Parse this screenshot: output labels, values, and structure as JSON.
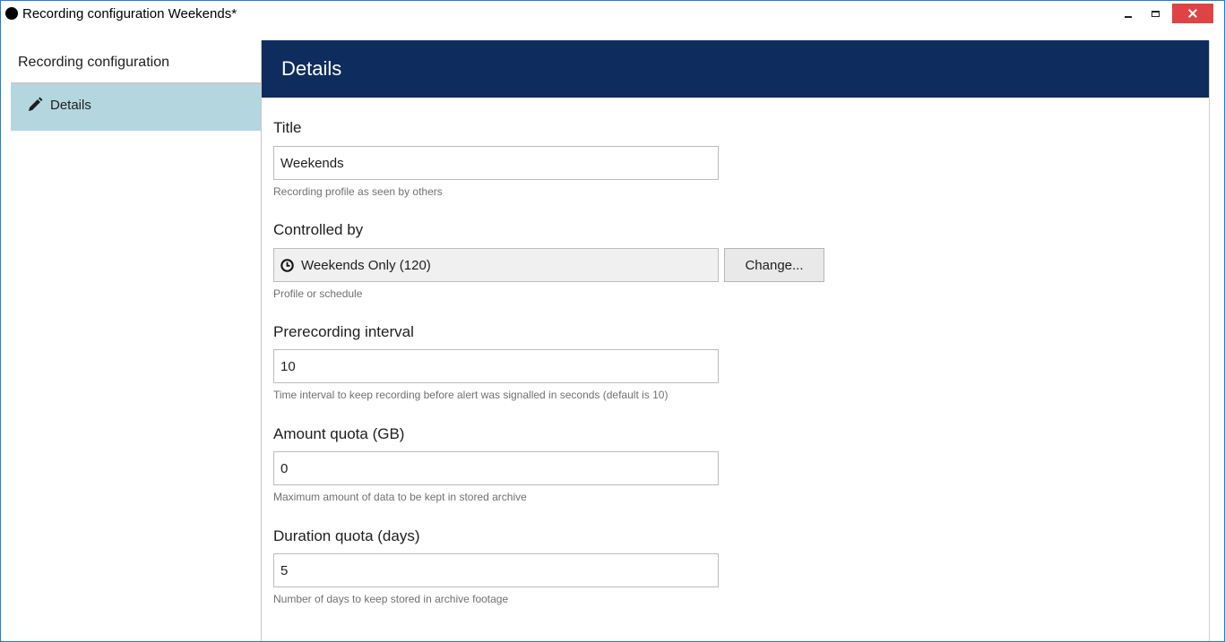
{
  "window": {
    "title": "Recording configuration Weekends*"
  },
  "sidebar": {
    "header": "Recording configuration",
    "items": [
      {
        "label": "Details",
        "icon": "pencil-icon",
        "selected": true
      }
    ]
  },
  "main": {
    "header": "Details",
    "fields": {
      "title": {
        "label": "Title",
        "value": "Weekends",
        "hint": "Recording profile as seen by others"
      },
      "controlled_by": {
        "label": "Controlled by",
        "value": "Weekends Only (120)",
        "icon": "clock-icon",
        "button": "Change...",
        "hint": "Profile or schedule"
      },
      "prerecording": {
        "label": "Prerecording interval",
        "value": "10",
        "hint": "Time interval to keep recording before alert was signalled in seconds (default is 10)"
      },
      "amount_quota": {
        "label": "Amount quota (GB)",
        "value": "0",
        "hint": "Maximum amount of data to be kept in stored archive"
      },
      "duration_quota": {
        "label": "Duration quota (days)",
        "value": "5",
        "hint": "Number of days to keep stored in archive footage"
      }
    }
  },
  "colors": {
    "header_bg": "#0e2c5e",
    "sidebar_selected": "#b4d6df",
    "close_button": "#e04343",
    "window_border": "#1c7ed6"
  }
}
